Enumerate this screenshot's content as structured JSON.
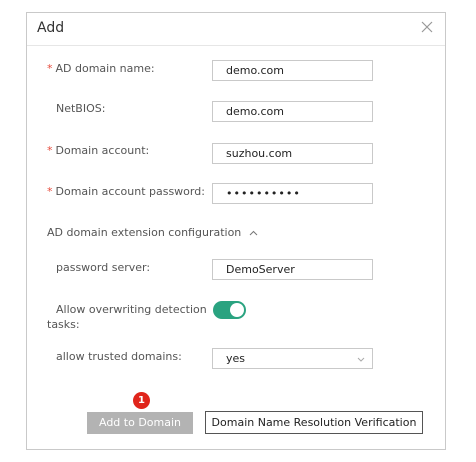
{
  "dialog": {
    "title": "Add",
    "fields": {
      "ad_domain_name": {
        "label": "AD domain name:",
        "value": "demo.com",
        "required": "*"
      },
      "netbios": {
        "label": "NetBIOS:",
        "value": "demo.com"
      },
      "domain_account": {
        "label": "Domain account:",
        "value": "suzhou.com",
        "required": "*"
      },
      "domain_password": {
        "label": "Domain account password:",
        "value": "••••••••••",
        "required": "*"
      }
    },
    "extension": {
      "section_title": "AD domain extension configuration",
      "password_server": {
        "label": "password server:",
        "value": "DemoServer"
      },
      "allow_overwriting": {
        "label_line1": "Allow overwriting detection",
        "label_line2": "tasks:",
        "state": "on"
      },
      "allow_trusted": {
        "label": "allow trusted domains:",
        "value": "yes"
      }
    },
    "buttons": {
      "add_to_domain": "Add to Domain",
      "resolution_verification": "Domain Name Resolution Verification",
      "step_badge": "1"
    }
  },
  "colors": {
    "accent_green": "#2aa380",
    "required_red": "#e64a3b",
    "badge_red": "#e0251b",
    "disabled_button": "#b3b3b3"
  },
  "icons": {
    "close": "close-icon",
    "section_toggle": "chevron-up-icon",
    "select_arrow": "chevron-down-icon"
  }
}
